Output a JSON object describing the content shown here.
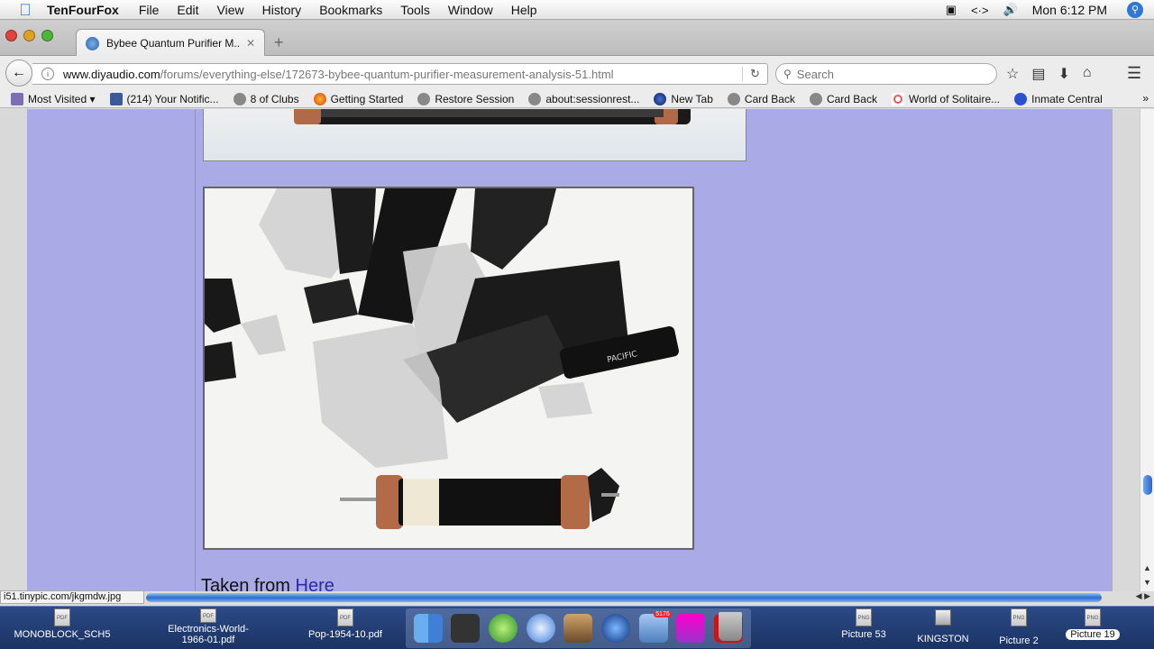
{
  "menubar": {
    "app_name": "TenFourFox",
    "items": [
      "File",
      "Edit",
      "View",
      "History",
      "Bookmarks",
      "Tools",
      "Window",
      "Help"
    ],
    "clock": "Mon 6:12 PM"
  },
  "tab": {
    "title": "Bybee Quantum Purifier M..."
  },
  "urlbar": {
    "domain": "www.diyaudio.com",
    "path": "/forums/everything-else/172673-bybee-quantum-purifier-measurement-analysis-51.html"
  },
  "search": {
    "placeholder": "Search"
  },
  "bookmarks": {
    "items": [
      "Most Visited",
      "(214) Your Notific...",
      "8 of Clubs",
      "Getting Started",
      "Restore Session",
      "about:sessionrest...",
      "New Tab",
      "Card Back",
      "Card Back",
      "World of Solitaire...",
      "Inmate Central"
    ]
  },
  "content": {
    "caption_text": "Taken from",
    "caption_link": "Here",
    "image_label": "PACIFIC"
  },
  "status": {
    "link": "i51.tinypic.com/jkgmdw.jpg"
  },
  "dock": {
    "left_files": [
      {
        "label": "MONOBLOCK_SCH5",
        "icon": "PDF"
      },
      {
        "label": "Electronics-World-1966-01.pdf",
        "icon": "PDF"
      },
      {
        "label": "Pop-1954-10.pdf",
        "icon": "PDF"
      }
    ],
    "mail_badge": "5176",
    "right_files": [
      {
        "label": "Picture 53",
        "icon": "PNG"
      },
      {
        "label": "KINGSTON",
        "icon": ""
      },
      {
        "label": "Picture 2",
        "icon": "PNG"
      },
      {
        "label": "Picture 19",
        "icon": "PNG"
      }
    ]
  },
  "colors": {
    "page_background": "#aaaae6",
    "link": "#2a2aa8",
    "accent": "#2c6bd0"
  }
}
